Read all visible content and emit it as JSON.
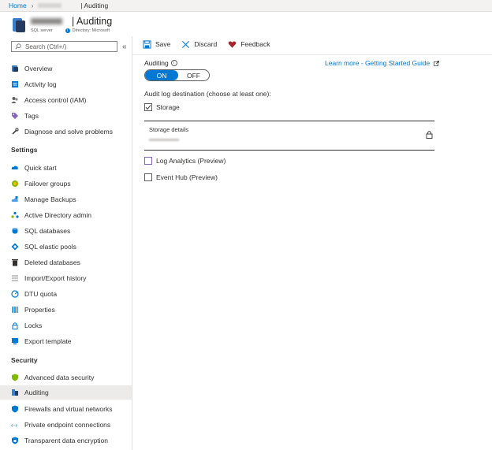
{
  "breadcrumb": {
    "home": "Home",
    "current": "| Auditing"
  },
  "resource": {
    "title": "| Auditing",
    "type": "SQL server",
    "directory": "Directory: Microsoft"
  },
  "search": {
    "placeholder": "Search (Ctrl+/)"
  },
  "sidebar": {
    "items": [
      {
        "label": "Overview",
        "icon": "database-icon"
      },
      {
        "label": "Activity log",
        "icon": "activity-log-icon"
      },
      {
        "label": "Access control (IAM)",
        "icon": "people-icon"
      },
      {
        "label": "Tags",
        "icon": "tag-icon"
      },
      {
        "label": "Diagnose and solve problems",
        "icon": "wrench-icon"
      }
    ],
    "settings_label": "Settings",
    "settings_items": [
      {
        "label": "Quick start",
        "icon": "cloud-icon"
      },
      {
        "label": "Failover groups",
        "icon": "globe-icon"
      },
      {
        "label": "Manage Backups",
        "icon": "backup-cloud-icon"
      },
      {
        "label": "Active Directory admin",
        "icon": "ad-admin-icon"
      },
      {
        "label": "SQL databases",
        "icon": "sql-database-icon"
      },
      {
        "label": "SQL elastic pools",
        "icon": "elastic-pool-icon"
      },
      {
        "label": "Deleted databases",
        "icon": "trash-icon"
      },
      {
        "label": "Import/Export history",
        "icon": "list-icon"
      },
      {
        "label": "DTU quota",
        "icon": "quota-icon"
      },
      {
        "label": "Properties",
        "icon": "properties-icon"
      },
      {
        "label": "Locks",
        "icon": "lock-icon"
      },
      {
        "label": "Export template",
        "icon": "template-icon"
      }
    ],
    "security_label": "Security",
    "security_items": [
      {
        "label": "Advanced data security",
        "icon": "shield-icon"
      },
      {
        "label": "Auditing",
        "icon": "auditing-icon"
      },
      {
        "label": "Firewalls and virtual networks",
        "icon": "firewall-icon"
      },
      {
        "label": "Private endpoint connections",
        "icon": "endpoint-icon"
      },
      {
        "label": "Transparent data encryption",
        "icon": "encryption-shield-icon"
      }
    ]
  },
  "toolbar": {
    "save_label": "Save",
    "discard_label": "Discard",
    "feedback_label": "Feedback"
  },
  "auditing": {
    "label": "Auditing",
    "toggle_on": "ON",
    "toggle_off": "OFF",
    "learn_more": "Learn more - Getting Started Guide",
    "destination_label": "Audit log destination (choose at least one):",
    "storage_label": "Storage",
    "storage_details_label": "Storage details",
    "log_analytics_label": "Log Analytics (Preview)",
    "event_hub_label": "Event Hub (Preview)"
  },
  "colors": {
    "accent": "#0078d4",
    "feedback_heart": "#a4262c",
    "active_nav": "#edebe9"
  }
}
